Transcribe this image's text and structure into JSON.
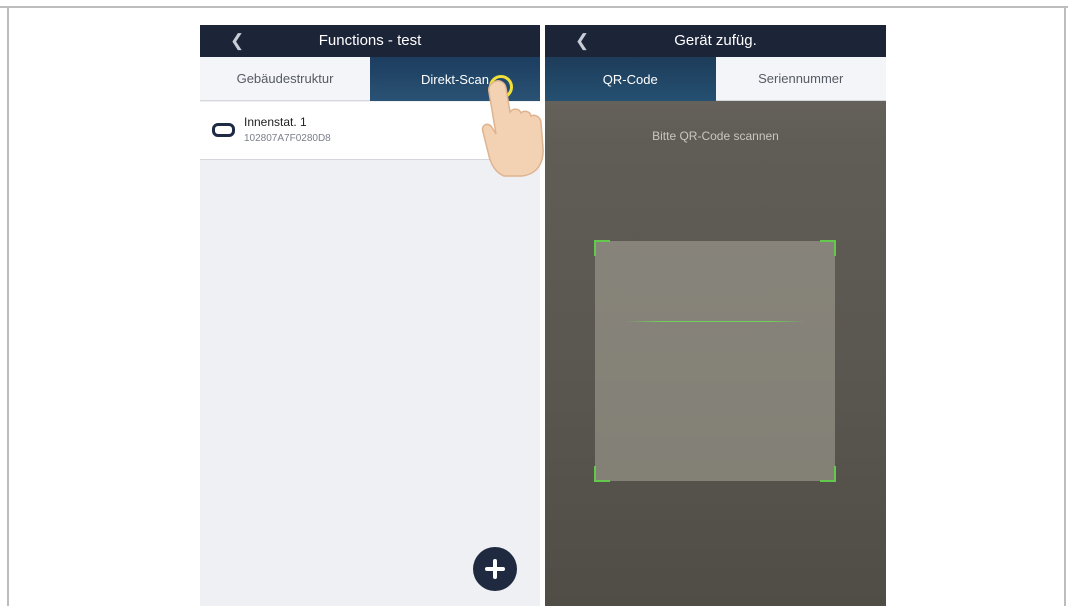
{
  "left_screen": {
    "navbar": {
      "back_icon": "chevron-left-icon",
      "title": "Functions - test"
    },
    "tabs": [
      {
        "label": "Gebäudestruktur",
        "active": false
      },
      {
        "label": "Direkt-Scan",
        "active": true
      }
    ],
    "devices": [
      {
        "icon": "device-icon",
        "name": "Innenstat. 1",
        "serial": "102807A7F0280D8"
      }
    ],
    "add_button": {
      "icon": "plus-icon"
    }
  },
  "right_screen": {
    "navbar": {
      "back_icon": "chevron-left-icon",
      "title": "Gerät zufüg."
    },
    "tabs": [
      {
        "label": "QR-Code",
        "active": true
      },
      {
        "label": "Seriennummer",
        "active": false
      }
    ],
    "scan_hint": "Bitte QR-Code scannen"
  },
  "colors": {
    "navbar": "#1c2438",
    "active_tab": "#1c3d5f",
    "scanner_corner": "#63c94c",
    "tap_indicator": "#f2e03a"
  }
}
